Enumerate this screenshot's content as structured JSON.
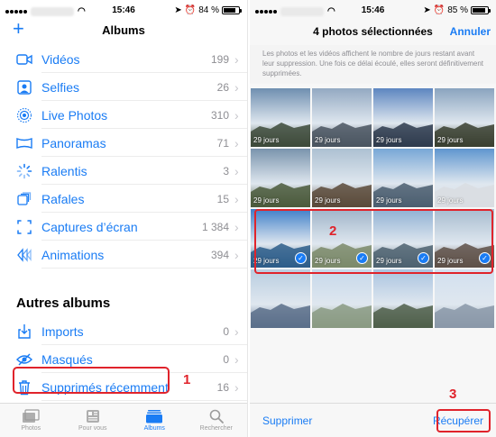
{
  "left": {
    "status": {
      "time": "15:46",
      "battery": "84 %",
      "battery_level": 0.84
    },
    "nav": {
      "title": "Albums",
      "add_icon": "plus-icon"
    },
    "albums": [
      {
        "name": "Vidéos",
        "count": "199",
        "icon": "video-icon"
      },
      {
        "name": "Selfies",
        "count": "26",
        "icon": "selfie-icon"
      },
      {
        "name": "Live Photos",
        "count": "310",
        "icon": "live-photo-icon"
      },
      {
        "name": "Panoramas",
        "count": "71",
        "icon": "panorama-icon"
      },
      {
        "name": "Ralentis",
        "count": "3",
        "icon": "slowmo-icon"
      },
      {
        "name": "Rafales",
        "count": "15",
        "icon": "burst-icon"
      },
      {
        "name": "Captures d’écran",
        "count": "1 384",
        "icon": "screenshot-icon"
      },
      {
        "name": "Animations",
        "count": "394",
        "icon": "animation-icon"
      }
    ],
    "other_title": "Autres albums",
    "other_albums": [
      {
        "name": "Imports",
        "count": "0",
        "icon": "import-icon"
      },
      {
        "name": "Masqués",
        "count": "0",
        "icon": "hidden-icon"
      },
      {
        "name": "Supprimés récemment",
        "count": "16",
        "icon": "trash-icon"
      }
    ],
    "step_number": "1",
    "tabs": [
      {
        "label": "Photos",
        "icon": "photos-tab-icon",
        "active": false
      },
      {
        "label": "Pour vous",
        "icon": "for-you-tab-icon",
        "active": false
      },
      {
        "label": "Albums",
        "icon": "albums-tab-icon",
        "active": true
      },
      {
        "label": "Rechercher",
        "icon": "search-icon",
        "active": false
      }
    ]
  },
  "right": {
    "status": {
      "time": "15:46",
      "battery": "85 %",
      "battery_level": 0.85
    },
    "nav": {
      "title": "4 photos sélectionnées",
      "cancel": "Annuler"
    },
    "notice": "Les photos et les vidéos affichent le nombre de jours restant avant leur suppression. Une fois ce délai écoulé, elles seront définitivement supprimées.",
    "photos": [
      {
        "days": "29 jours",
        "selected": false,
        "sky": "#6f8fb0",
        "ground": "#3d4a3a"
      },
      {
        "days": "29 jours",
        "selected": false,
        "sky": "#93a9c2",
        "ground": "#4a5560"
      },
      {
        "days": "29 jours",
        "selected": false,
        "sky": "#5d86c0",
        "ground": "#2e3b4d"
      },
      {
        "days": "29 jours",
        "selected": false,
        "sky": "#8aa4bf",
        "ground": "#3a4030"
      },
      {
        "days": "29 jours",
        "selected": false,
        "sky": "#7a94ad",
        "ground": "#4b5a3c"
      },
      {
        "days": "29 jours",
        "selected": false,
        "sky": "#adc0d2",
        "ground": "#5a4a3a"
      },
      {
        "days": "29 jours",
        "selected": false,
        "sky": "#78a7d6",
        "ground": "#4b5e70"
      },
      {
        "days": "29 jours",
        "selected": false,
        "sky": "#5f96cf",
        "ground": "#d9dde2"
      },
      {
        "days": "29 jours",
        "selected": true,
        "sky": "#3f7fc9",
        "ground": "#2d5d8a"
      },
      {
        "days": "29 jours",
        "selected": true,
        "sky": "#9fb4c9",
        "ground": "#7b8a6a"
      },
      {
        "days": "29 jours",
        "selected": true,
        "sky": "#8fb0d3",
        "ground": "#4d6170"
      },
      {
        "days": "29 jours",
        "selected": true,
        "sky": "#a7bccf",
        "ground": "#5e5048"
      },
      {
        "days": "",
        "selected": false,
        "sky": "#b9cde0",
        "ground": "#5a6f8a"
      },
      {
        "days": "",
        "selected": false,
        "sky": "#c6d8ea",
        "ground": "#8a9a82"
      },
      {
        "days": "",
        "selected": false,
        "sky": "#a9c3e0",
        "ground": "#4f5f4a"
      },
      {
        "days": "",
        "selected": false,
        "sky": "#d2e0ef",
        "ground": "#8a98a8"
      }
    ],
    "step_selection": "2",
    "step_recover": "3",
    "actions": {
      "delete": "Supprimer",
      "recover": "Récupérer"
    }
  },
  "colors": {
    "accent": "#1a7cf4",
    "annotation": "#e0232b"
  }
}
